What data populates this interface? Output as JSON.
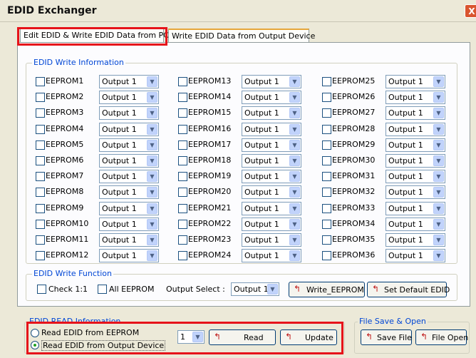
{
  "window": {
    "title": "EDID Exchanger",
    "close": "X"
  },
  "tabs": [
    {
      "label": "Edit EDID & Write EDID Data from PC"
    },
    {
      "label": "Write EDID Data from Output Device"
    }
  ],
  "write_info": {
    "legend": "EDID Write Information",
    "rows": [
      [
        {
          "label": "EEPROM1",
          "output": "Output 1"
        },
        {
          "label": "EEPROM13",
          "output": "Output 1"
        },
        {
          "label": "EEPROM25",
          "output": "Output 1"
        }
      ],
      [
        {
          "label": "EEPROM2",
          "output": "Output 1"
        },
        {
          "label": "EEPROM14",
          "output": "Output 1"
        },
        {
          "label": "EEPROM26",
          "output": "Output 1"
        }
      ],
      [
        {
          "label": "EEPROM3",
          "output": "Output 1"
        },
        {
          "label": "EEPROM15",
          "output": "Output 1"
        },
        {
          "label": "EEPROM27",
          "output": "Output 1"
        }
      ],
      [
        {
          "label": "EEPROM4",
          "output": "Output 1"
        },
        {
          "label": "EEPROM16",
          "output": "Output 1"
        },
        {
          "label": "EEPROM28",
          "output": "Output 1"
        }
      ],
      [
        {
          "label": "EEPROM5",
          "output": "Output 1"
        },
        {
          "label": "EEPROM17",
          "output": "Output 1"
        },
        {
          "label": "EEPROM29",
          "output": "Output 1"
        }
      ],
      [
        {
          "label": "EEPROM6",
          "output": "Output 1"
        },
        {
          "label": "EEPROM18",
          "output": "Output 1"
        },
        {
          "label": "EEPROM30",
          "output": "Output 1"
        }
      ],
      [
        {
          "label": "EEPROM7",
          "output": "Output 1"
        },
        {
          "label": "EEPROM19",
          "output": "Output 1"
        },
        {
          "label": "EEPROM31",
          "output": "Output 1"
        }
      ],
      [
        {
          "label": "EEPROM8",
          "output": "Output 1"
        },
        {
          "label": "EEPROM20",
          "output": "Output 1"
        },
        {
          "label": "EEPROM32",
          "output": "Output 1"
        }
      ],
      [
        {
          "label": "EEPROM9",
          "output": "Output 1"
        },
        {
          "label": "EEPROM21",
          "output": "Output 1"
        },
        {
          "label": "EEPROM33",
          "output": "Output 1"
        }
      ],
      [
        {
          "label": "EEPROM10",
          "output": "Output 1"
        },
        {
          "label": "EEPROM22",
          "output": "Output 1"
        },
        {
          "label": "EEPROM34",
          "output": "Output 1"
        }
      ],
      [
        {
          "label": "EEPROM11",
          "output": "Output 1"
        },
        {
          "label": "EEPROM23",
          "output": "Output 1"
        },
        {
          "label": "EEPROM35",
          "output": "Output 1"
        }
      ],
      [
        {
          "label": "EEPROM12",
          "output": "Output 1"
        },
        {
          "label": "EEPROM24",
          "output": "Output 1"
        },
        {
          "label": "EEPROM36",
          "output": "Output 1"
        }
      ]
    ]
  },
  "write_function": {
    "legend": "EDID Write Function",
    "check11": "Check 1:1",
    "all_eeprom": "All EEPROM",
    "output_select_label": "Output Select :",
    "output_select_value": "Output 1",
    "write_eeprom": "Write_EEPROM",
    "set_default": "Set Default EDID"
  },
  "read_info": {
    "legend": "EDID READ Information",
    "radio_eeprom": "Read EDID from EEPROM",
    "radio_output": "Read EDID from Output Device",
    "num_value": "1",
    "read": "Read",
    "update": "Update"
  },
  "file": {
    "legend": "File Save & Open",
    "save": "Save File",
    "open": "File Open"
  },
  "icons": {
    "button_icon": "t-arrow-icon",
    "dropdown": "chevron-down-icon"
  },
  "colors": {
    "accent": "#0046d5",
    "highlight": "#e6131a"
  }
}
